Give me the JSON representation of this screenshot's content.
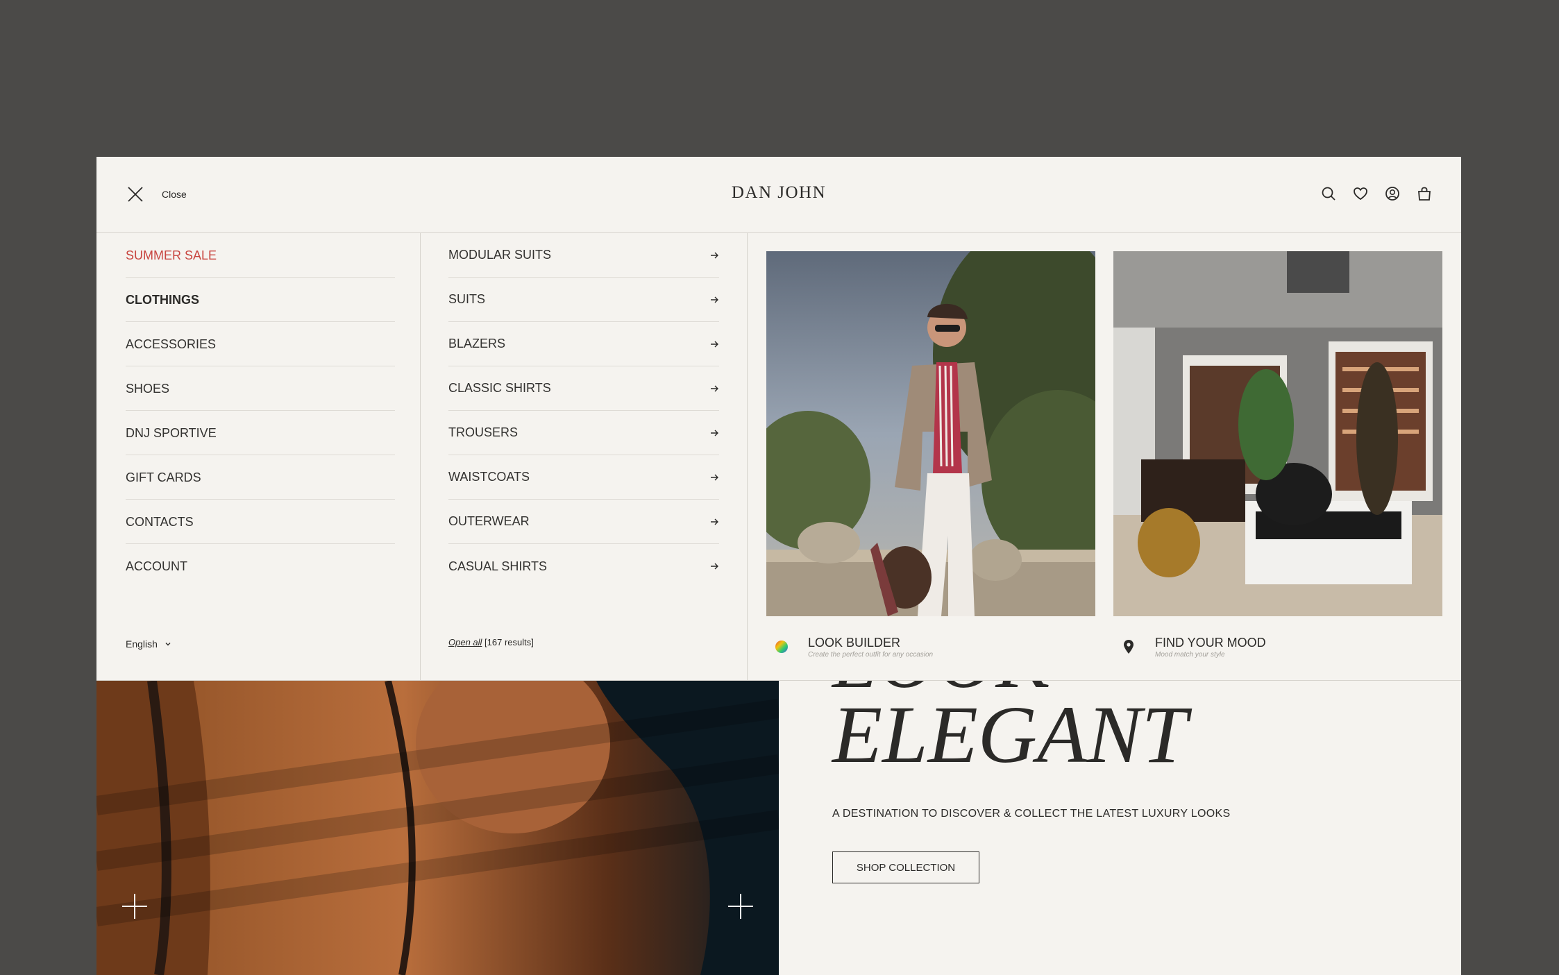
{
  "header": {
    "close_label": "Close",
    "logo": "DAN JOHN",
    "icons": [
      "search-icon",
      "heart-icon",
      "user-icon",
      "bag-icon"
    ]
  },
  "menu": {
    "main_items": [
      {
        "label": "SUMMER SALE",
        "style": "sale"
      },
      {
        "label": "CLOTHINGS",
        "style": "active"
      },
      {
        "label": "ACCESSORIES",
        "style": ""
      },
      {
        "label": "SHOES",
        "style": ""
      },
      {
        "label": "DNJ SPORTIVE",
        "style": ""
      },
      {
        "label": "GIFT CARDS",
        "style": ""
      },
      {
        "label": "CONTACTS",
        "style": ""
      },
      {
        "label": "ACCOUNT",
        "style": ""
      }
    ],
    "language": "English",
    "sub_items": [
      "MODULAR SUITS",
      "SUITS",
      "BLAZERS",
      "CLASSIC SHIRTS",
      "TROUSERS",
      "WAISTCOATS",
      "OUTERWEAR",
      "CASUAL SHIRTS"
    ],
    "open_all_label": "Open all",
    "results_label": "[167 results]",
    "cards": [
      {
        "title": "LOOK BUILDER",
        "subtitle": "Create the perfect outfit for any occasion",
        "icon": "color-wheel-icon"
      },
      {
        "title": "FIND YOUR MOOD",
        "subtitle": "Mood match your style",
        "icon": "location-pin-icon"
      }
    ]
  },
  "hero": {
    "title_prev": "LOOK",
    "title": "ELEGANT",
    "subtitle": "A DESTINATION TO DISCOVER & COLLECT THE LATEST LUXURY LOOKS",
    "button_label": "SHOP COLLECTION"
  },
  "colors": {
    "backdrop": "#4b4a48",
    "panel": "#f5f3ef",
    "text": "#2b2a28",
    "sale": "#c8453f",
    "divider": "#d6d3cd"
  }
}
